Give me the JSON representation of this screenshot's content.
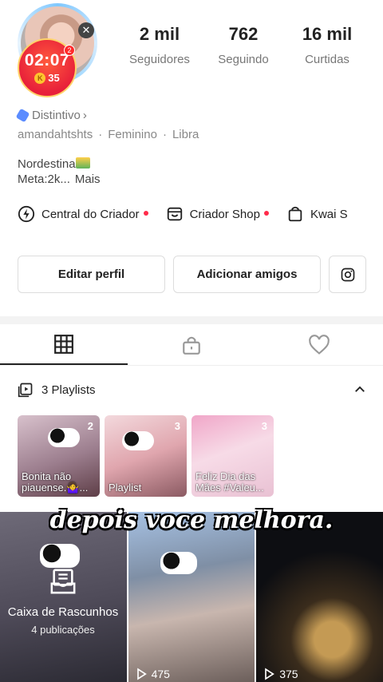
{
  "profile": {
    "live_timer": "02:07",
    "live_notification_count": "2",
    "coin_label": "K",
    "coins": "35",
    "close_symbol": "✕",
    "stats": [
      {
        "value": "2 mil",
        "label": "Seguidores"
      },
      {
        "value": "762",
        "label": "Seguindo"
      },
      {
        "value": "16 mil",
        "label": "Curtidas"
      }
    ],
    "badge": "Distintivo",
    "username": "amandahtshts",
    "gender": "Feminino",
    "sign": "Libra",
    "separator": "·",
    "bio_line1": "Nordestina",
    "bio_line2": "Meta:2k...",
    "bio_more": "Mais"
  },
  "shortcuts": [
    {
      "label": "Central do Criador",
      "icon": "lightning-icon",
      "dot": true
    },
    {
      "label": "Criador Shop",
      "icon": "shop-icon",
      "dot": true
    },
    {
      "label": "Kwai S",
      "icon": "bag-icon",
      "dot": false
    }
  ],
  "buttons": {
    "edit": "Editar perfil",
    "add": "Adicionar amigos",
    "instagram_icon": "instagram-icon"
  },
  "tabs": [
    {
      "icon": "grid-icon",
      "active": true
    },
    {
      "icon": "lock-icon",
      "active": false
    },
    {
      "icon": "heart-icon",
      "active": false
    }
  ],
  "playlists": {
    "header": "3 Playlists",
    "items": [
      {
        "count": "2",
        "title": "Bonita não piauense.🤷‍♀️..."
      },
      {
        "count": "3",
        "title": "Playlist"
      },
      {
        "count": "3",
        "title": "Feliz Dia das Mães #Valeu..."
      }
    ]
  },
  "grid": {
    "caption": "depois voce melhora.",
    "draft_title": "Caixa de Rascunhos",
    "draft_sub": "4 publicações",
    "views": [
      "475",
      "375"
    ]
  }
}
